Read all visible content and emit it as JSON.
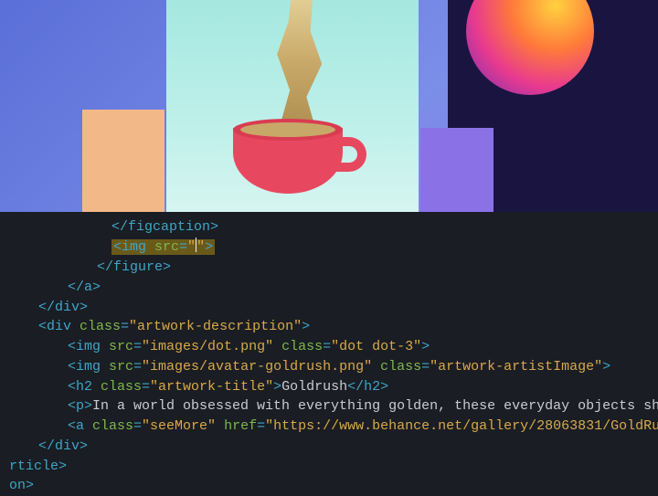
{
  "code": {
    "lines": [
      {
        "indent": 7,
        "tokens": [
          {
            "t": "tag",
            "v": "</figcaption>"
          }
        ]
      },
      {
        "indent": 7,
        "highlight": true,
        "tokens": [
          {
            "t": "tag",
            "v": "<img "
          },
          {
            "t": "attr",
            "v": "src"
          },
          {
            "t": "tag",
            "v": "="
          },
          {
            "t": "str",
            "v": "\""
          },
          {
            "t": "cursor",
            "v": ""
          },
          {
            "t": "str",
            "v": "\""
          },
          {
            "t": "tag",
            "v": ">"
          }
        ]
      },
      {
        "indent": 6,
        "tokens": [
          {
            "t": "tag",
            "v": "</figure>"
          }
        ]
      },
      {
        "indent": 4,
        "tokens": [
          {
            "t": "tag",
            "v": "</a>"
          }
        ]
      },
      {
        "indent": 2,
        "tokens": [
          {
            "t": "tag",
            "v": "</div>"
          }
        ]
      },
      {
        "indent": 2,
        "tokens": [
          {
            "t": "tag",
            "v": "<div "
          },
          {
            "t": "attr",
            "v": "class"
          },
          {
            "t": "tag",
            "v": "="
          },
          {
            "t": "str",
            "v": "\"artwork-description\""
          },
          {
            "t": "tag",
            "v": ">"
          }
        ]
      },
      {
        "indent": 4,
        "tokens": [
          {
            "t": "tag",
            "v": "<img "
          },
          {
            "t": "attr",
            "v": "src"
          },
          {
            "t": "tag",
            "v": "="
          },
          {
            "t": "str",
            "v": "\"images/dot.png\""
          },
          {
            "t": "tag",
            "v": " "
          },
          {
            "t": "attr",
            "v": "class"
          },
          {
            "t": "tag",
            "v": "="
          },
          {
            "t": "str",
            "v": "\"dot dot-3\""
          },
          {
            "t": "tag",
            "v": ">"
          }
        ]
      },
      {
        "indent": 4,
        "tokens": [
          {
            "t": "tag",
            "v": "<img "
          },
          {
            "t": "attr",
            "v": "src"
          },
          {
            "t": "tag",
            "v": "="
          },
          {
            "t": "str",
            "v": "\"images/avatar-goldrush.png\""
          },
          {
            "t": "tag",
            "v": " "
          },
          {
            "t": "attr",
            "v": "class"
          },
          {
            "t": "tag",
            "v": "="
          },
          {
            "t": "str",
            "v": "\"artwork-artistImage\""
          },
          {
            "t": "tag",
            "v": ">"
          }
        ]
      },
      {
        "indent": 4,
        "tokens": [
          {
            "t": "tag",
            "v": "<h2 "
          },
          {
            "t": "attr",
            "v": "class"
          },
          {
            "t": "tag",
            "v": "="
          },
          {
            "t": "str",
            "v": "\"artwork-title\""
          },
          {
            "t": "tag",
            "v": ">"
          },
          {
            "t": "txt",
            "v": "Goldrush"
          },
          {
            "t": "tag",
            "v": "</h2>"
          }
        ]
      },
      {
        "indent": 4,
        "tokens": [
          {
            "t": "tag",
            "v": "<p>"
          },
          {
            "t": "txt",
            "v": "In a world obsessed with everything golden, these everyday objects sh"
          }
        ]
      },
      {
        "indent": 4,
        "tokens": [
          {
            "t": "tag",
            "v": "<a "
          },
          {
            "t": "attr",
            "v": "class"
          },
          {
            "t": "tag",
            "v": "="
          },
          {
            "t": "str",
            "v": "\"seeMore\""
          },
          {
            "t": "tag",
            "v": " "
          },
          {
            "t": "attr",
            "v": "href"
          },
          {
            "t": "tag",
            "v": "="
          },
          {
            "t": "str",
            "v": "\"https://www.behance.net/gallery/28063831/GoldRu"
          }
        ]
      },
      {
        "indent": 2,
        "tokens": [
          {
            "t": "tag",
            "v": "</div>"
          }
        ]
      },
      {
        "indent": 0,
        "tokens": [
          {
            "t": "tag",
            "v": "rticle>"
          }
        ]
      },
      {
        "indent": 0,
        "tokens": [
          {
            "t": "txt",
            "v": ""
          }
        ]
      },
      {
        "indent": 0,
        "tokens": [
          {
            "t": "tag",
            "v": "on>"
          }
        ]
      }
    ]
  },
  "colors": {
    "tag": "#3fa5c9",
    "attr": "#7db84a",
    "str": "#d9a94a",
    "txt": "#c9ccd1",
    "highlight_bg": "#6a5a1a",
    "editor_bg": "#1a1d23"
  }
}
